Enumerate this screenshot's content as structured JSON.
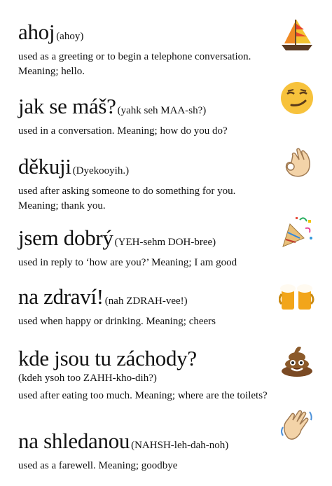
{
  "entries": [
    {
      "word": "ahoj",
      "pron": "(ahoy)",
      "desc": "used as a greeting or to begin a telephone conversation. Meaning; hello.",
      "icon": "sailboat-icon"
    },
    {
      "word": "jak se máš?",
      "pron": "(yahk seh MAA-sh?)",
      "desc": "used in a conversation. Meaning; how do you do?",
      "icon": "smirking-face-icon"
    },
    {
      "word": "děkuji",
      "pron": "(Dyekooyih.)",
      "desc": "used after asking someone to do something for you. Meaning; thank you.",
      "icon": "ok-hand-icon"
    },
    {
      "word": "jsem dobrý",
      "pron": "(YEH-sehm DOH-bree)",
      "desc": "used in reply to ‘how are you?’ Meaning; I am good",
      "icon": "party-popper-icon"
    },
    {
      "word": "na zdraví!",
      "pron": "(nah ZDRAH-vee!)",
      "desc": "used when happy or drinking. Meaning; cheers",
      "icon": "beer-mugs-icon"
    },
    {
      "word": "kde jsou tu záchody?",
      "pron": "(kdeh ysoh too ZAHH-kho-dih?)",
      "desc": "used after eating too much. Meaning; where are the toilets?",
      "icon": "poop-icon"
    },
    {
      "word": "na shledanou",
      "pron": "(NAHSH-leh-dah-noh)",
      "desc": "used as a farewell. Meaning; goodbye",
      "icon": "waving-hand-icon"
    }
  ]
}
